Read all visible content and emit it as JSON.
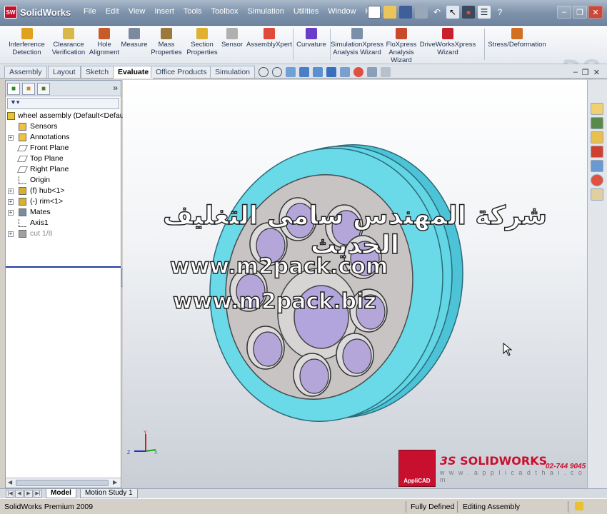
{
  "window": {
    "brand": "SolidWorks",
    "badge": "SW",
    "menu": [
      "File",
      "Edit",
      "View",
      "Insert",
      "Tools",
      "Toolbox",
      "Simulation",
      "Utilities",
      "Window",
      "Help"
    ],
    "controls": [
      "minimize",
      "restore",
      "close"
    ]
  },
  "commands": [
    {
      "label": "Interference\nDetection",
      "icon": "interference-icon",
      "color": "#e0a020"
    },
    {
      "label": "Clearance\nVerification",
      "icon": "clearance-icon",
      "color": "#d7b84a"
    },
    {
      "label": "Hole\nAlignment",
      "icon": "hole-icon",
      "color": "#c75c2a"
    },
    {
      "label": "Measure",
      "icon": "measure-icon",
      "color": "#7c8aa0"
    },
    {
      "label": "Mass\nProperties",
      "icon": "scale-icon",
      "color": "#9a7a3a"
    },
    {
      "label": "Section\nProperties",
      "icon": "section-icon",
      "color": "#e0b030"
    },
    {
      "label": "Sensor",
      "icon": "sensor-icon",
      "color": "#b0b0b0"
    },
    {
      "label": "AssemblyXpert",
      "icon": "assemblyxpert-icon",
      "color": "#e04a3a"
    },
    {
      "label": "Curvature",
      "icon": "curvature-icon",
      "color": "#6a3cc8"
    },
    {
      "label": "SimulationXpress\nAnalysis Wizard",
      "icon": "simulation-icon",
      "color": "#7a8fa8"
    },
    {
      "label": "FloXpress\nAnalysis\nWizard",
      "icon": "floxpress-icon",
      "color": "#c84a2a"
    },
    {
      "label": "DriveWorksXpress\nWizard",
      "icon": "driveworks-icon",
      "color": "#c8202a"
    },
    {
      "label": "Stress/Deformation",
      "icon": "stress-icon",
      "color": "#d07020"
    }
  ],
  "tabs": [
    {
      "label": "Assembly",
      "active": false
    },
    {
      "label": "Layout",
      "active": false
    },
    {
      "label": "Sketch",
      "active": false
    },
    {
      "label": "Evaluate",
      "active": true
    },
    {
      "label": "Office Products",
      "active": false
    },
    {
      "label": "Simulation",
      "active": false
    }
  ],
  "tree": {
    "root": "wheel assembly  (Default<Defau",
    "nodes": [
      {
        "label": "Sensors",
        "expandable": false,
        "icon": "sensor-folder-icon",
        "grey": false
      },
      {
        "label": "Annotations",
        "expandable": true,
        "icon": "annotations-icon",
        "grey": false
      },
      {
        "label": "Front Plane",
        "expandable": false,
        "icon": "plane-icon",
        "grey": false
      },
      {
        "label": "Top Plane",
        "expandable": false,
        "icon": "plane-icon",
        "grey": false
      },
      {
        "label": "Right Plane",
        "expandable": false,
        "icon": "plane-icon",
        "grey": false
      },
      {
        "label": "Origin",
        "expandable": false,
        "icon": "origin-icon",
        "grey": false
      },
      {
        "label": "(f) hub<1>",
        "expandable": true,
        "icon": "part-icon",
        "grey": false
      },
      {
        "label": "(-) rim<1>",
        "expandable": true,
        "icon": "part-icon",
        "grey": false
      },
      {
        "label": "Mates",
        "expandable": true,
        "icon": "mates-icon",
        "grey": false
      },
      {
        "label": "Axis1",
        "expandable": false,
        "icon": "axis-icon",
        "grey": false
      },
      {
        "label": "cut 1/8",
        "expandable": true,
        "icon": "cut-icon",
        "grey": true
      }
    ]
  },
  "watermark": {
    "arabic": "شركة المهندس سامى التغليف الحديث",
    "url1": "www.m2pack.com",
    "url2": "www.m2pack.biz"
  },
  "reseller": {
    "box_label": "AppliCAD",
    "ds": "3S",
    "name": "SOLIDWORKS",
    "phone": "02-744 9045",
    "site": "w w w . a p p l i c a d t h a i . c o m"
  },
  "bottom_tabs": [
    {
      "label": "Model",
      "active": true
    },
    {
      "label": "Motion Study 1",
      "active": false
    }
  ],
  "status": {
    "product": "SolidWorks Premium 2009",
    "state": "Fully Defined",
    "mode": "Editing Assembly"
  },
  "colors": {
    "rim": "#5fd4e6",
    "hub": "#c7c3c3",
    "hole": "#b4a6d9",
    "accent": "#c8102e"
  }
}
